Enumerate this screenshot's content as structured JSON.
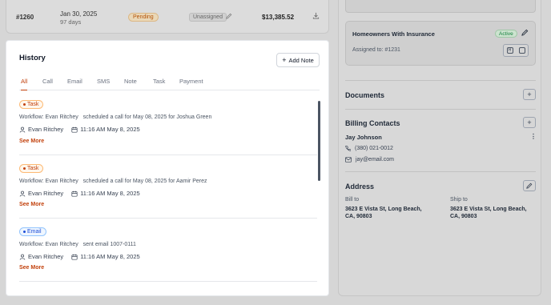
{
  "invoice": {
    "id": "#1260",
    "date": "Jan 30, 2025",
    "days": "97 days",
    "status": "Pending",
    "assignee": "Unassigned",
    "amount": "$13,385.52"
  },
  "history": {
    "title": "History",
    "add_note_label": "Add Note",
    "tabs": [
      "All",
      "Call",
      "Email",
      "SMS",
      "Note",
      "Task",
      "Payment"
    ],
    "active_tab": "All",
    "entries": [
      {
        "badge": "Task",
        "workflow": "Workflow: Evan Ritchey",
        "action": "scheduled a call for May 08, 2025 for Joshua Green",
        "user": "Evan Ritchey",
        "time": "11:16 AM May 8, 2025",
        "see_more": "See More"
      },
      {
        "badge": "Task",
        "workflow": "Workflow: Evan Ritchey",
        "action": "scheduled a call for May 08, 2025 for Aamir Perez",
        "user": "Evan Ritchey",
        "time": "11:16 AM May 8, 2025",
        "see_more": "See More"
      },
      {
        "badge": "Email",
        "workflow": "Workflow: Evan Ritchey",
        "action": "sent email 1007-0111",
        "user": "Evan Ritchey",
        "time": "11:16 AM May 8, 2025",
        "see_more": "See More"
      }
    ]
  },
  "insurance": {
    "title": "Homeowners With Insurance",
    "status": "Active",
    "assigned": "Assigned to: #1231"
  },
  "documents": {
    "title": "Documents"
  },
  "billing": {
    "title": "Billing Contacts",
    "name": "Jay Johnson",
    "phone": "(380) 021-0012",
    "email": "jay@email.com"
  },
  "address": {
    "title": "Address",
    "bill_label": "Bill to",
    "bill_value": "3623 E Vista St, Long Beach, CA, 90803",
    "ship_label": "Ship to",
    "ship_value": "3623 E Vista St, Long Beach, CA, 90803"
  },
  "colors": {
    "accent": "#c2410c",
    "active_green": "#15803d",
    "email_blue": "#1d4ed8"
  }
}
